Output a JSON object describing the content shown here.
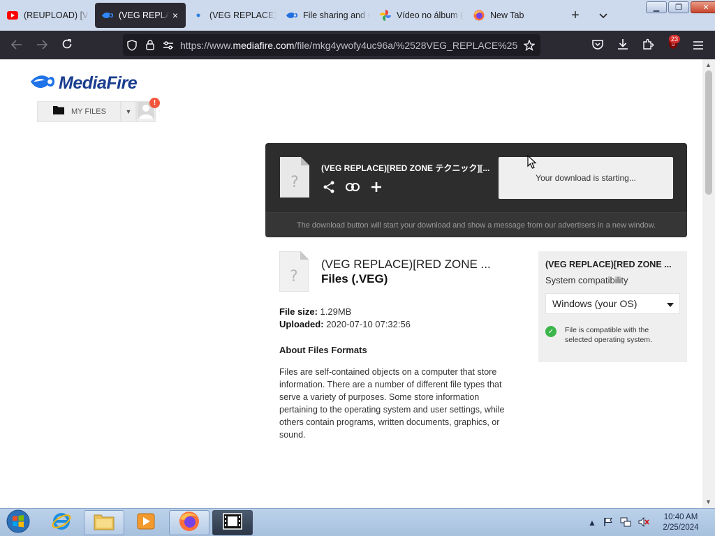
{
  "browser": {
    "tabs": [
      {
        "title": "(REUPLOAD) [VE",
        "favicon": "youtube-icon"
      },
      {
        "title": "(VEG REPLACE",
        "favicon": "mediafire-icon",
        "active": true
      },
      {
        "title": "(VEG REPLACE)[R",
        "favicon": "dot-icon"
      },
      {
        "title": "File sharing and s",
        "favicon": "mediafire-icon"
      },
      {
        "title": "Vídeo no álbum (",
        "favicon": "google-photos-icon"
      },
      {
        "title": "New Tab",
        "favicon": "firefox-icon"
      }
    ],
    "tab_close_glyph": "×",
    "new_tab_glyph": "+",
    "url_prefix": "https://www.",
    "url_domain": "mediafire.com",
    "url_path": "/file/mkg4ywofy4uc96a/%2528VEG_REPLACE%252",
    "extension_badge": "23",
    "colors": {
      "chrome_dark": "#2b2a33",
      "tabstrip": "#cdd9ec"
    }
  },
  "site": {
    "logo_text": "MediaFire",
    "my_files_label": "MY FILES",
    "notification_badge": "!"
  },
  "download": {
    "file_name": "(VEG REPLACE)[RED ZONE テクニック][...",
    "button_label": "Your download is starting...",
    "note": "The download button will start your download and show a message from our advertisers in a new window."
  },
  "file_info": {
    "title": "(VEG REPLACE)[RED ZONE ...",
    "type": "Files (.VEG)",
    "size_label": "File size:",
    "size_value": "1.29MB",
    "uploaded_label": "Uploaded:",
    "uploaded_value": "2020-07-10 07:32:56",
    "about_heading": "About Files Formats",
    "about_text": "Files are self-contained objects on a computer that store information. There are a number of different file types that serve a variety of purposes. Some store information pertaining to the operating system and user settings, while others contain programs, written documents, graphics, or sound."
  },
  "compat": {
    "title": "(VEG REPLACE)[RED ZONE ...",
    "subtitle": "System compatibility",
    "os_selected": "Windows (your OS)",
    "status": "File is compatible with the selected operating system.",
    "status_color": "#3cb54a"
  },
  "taskbar": {
    "time": "10:40 AM",
    "date": "2/25/2024"
  }
}
